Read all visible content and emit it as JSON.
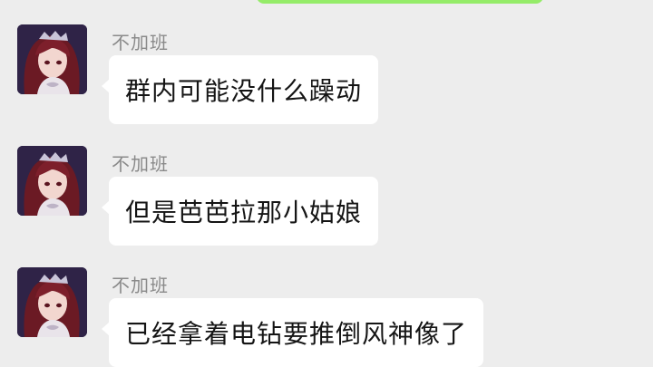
{
  "colors": {
    "background": "#ededed",
    "incoming_bubble": "#ffffff",
    "outgoing_bubble": "#95ec69",
    "sender_name": "#8a8a8a",
    "message_text": "#151515"
  },
  "messages": [
    {
      "sender": "不加班",
      "text": "群内可能没什么躁动",
      "avatar_icon": "anime-girl-avatar"
    },
    {
      "sender": "不加班",
      "text": "但是芭芭拉那小姑娘",
      "avatar_icon": "anime-girl-avatar"
    },
    {
      "sender": "不加班",
      "text": "已经拿着电钻要推倒风神像了",
      "avatar_icon": "anime-girl-avatar"
    }
  ]
}
